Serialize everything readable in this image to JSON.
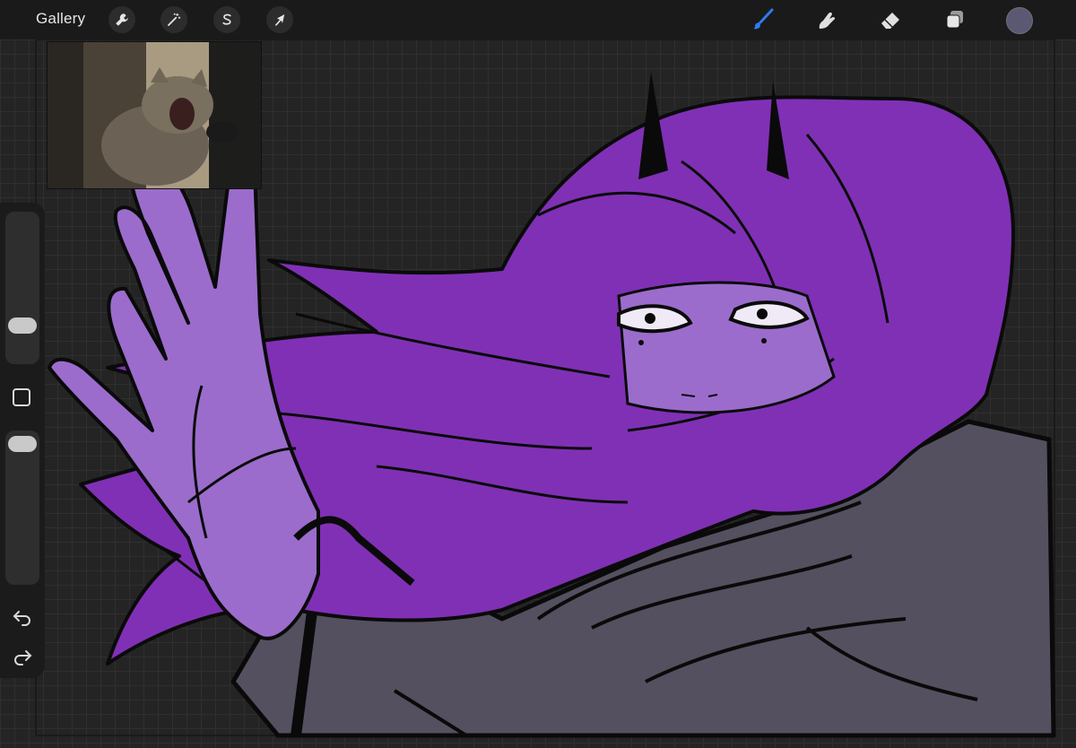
{
  "topbar": {
    "gallery_label": "Gallery",
    "left_tools": [
      {
        "name": "actions",
        "icon": "wrench-icon"
      },
      {
        "name": "adjustments",
        "icon": "magic-wand-icon"
      },
      {
        "name": "selection",
        "icon": "selection-s-icon"
      },
      {
        "name": "transform",
        "icon": "arrow-cursor-icon"
      }
    ],
    "right_tools": [
      {
        "name": "brush",
        "icon": "brush-icon",
        "active": true
      },
      {
        "name": "smudge",
        "icon": "smudge-finger-icon"
      },
      {
        "name": "eraser",
        "icon": "eraser-icon"
      },
      {
        "name": "layers",
        "icon": "layers-icon"
      }
    ],
    "current_color": "#5a5872",
    "accent_color": "#2e7bf0"
  },
  "sidebar": {
    "brush_size_level": 0.27,
    "opacity_level": 0.95,
    "icons": [
      "modify-square-icon",
      "undo-arrow-icon",
      "redo-arrow-icon"
    ]
  },
  "canvas": {
    "background": "#242424",
    "colors": {
      "hair": "#8030b5",
      "skin": "#9b6ccc",
      "coat": "#54505f",
      "line": "#0a0a0a"
    }
  }
}
